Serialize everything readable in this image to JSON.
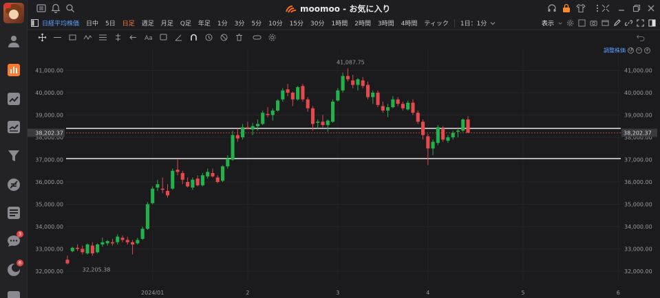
{
  "app": {
    "title": "moomoo - お気に入り"
  },
  "toolbar": {
    "index_label": "日経平均株価",
    "timeframes": [
      {
        "label": "日中",
        "active": false
      },
      {
        "label": "5日",
        "active": false
      },
      {
        "label": "日足",
        "active": true
      },
      {
        "label": "週足",
        "active": false
      },
      {
        "label": "月足",
        "active": false
      },
      {
        "label": "Q足",
        "active": false
      },
      {
        "label": "年足",
        "active": false
      },
      {
        "label": "1分",
        "active": false
      },
      {
        "label": "3分",
        "active": false
      },
      {
        "label": "5分",
        "active": false
      },
      {
        "label": "10分",
        "active": false
      },
      {
        "label": "15分",
        "active": false
      },
      {
        "label": "30分",
        "active": false
      },
      {
        "label": "1時間",
        "active": false
      },
      {
        "label": "2時間",
        "active": false
      },
      {
        "label": "3時間",
        "active": false
      },
      {
        "label": "4時間",
        "active": false
      },
      {
        "label": "ティック",
        "active": false
      }
    ],
    "custom_tf": "1日：1分",
    "display_label": "表示"
  },
  "chart": {
    "adjust_label": "調整株価",
    "current_price_label": "38,202.37",
    "high_label": "41,087.75",
    "low_label": "32,205.38"
  },
  "sidebar": {
    "badges": {
      "messages": "3",
      "news": "6"
    }
  },
  "chart_data": {
    "type": "candlestick",
    "y_ticks": [
      "41,000.00",
      "40,000.00",
      "39,000.00",
      "38,000.00",
      "37,000.00",
      "36,000.00",
      "35,000.00",
      "34,000.00",
      "33,000.00",
      "32,000.00"
    ],
    "y_tick_values": [
      41000,
      40000,
      39000,
      38000,
      37000,
      36000,
      35000,
      34000,
      33000,
      32000
    ],
    "ylim": [
      31600,
      42000
    ],
    "x_labels": [
      "2024/01",
      "2",
      "3",
      "4",
      "5",
      "6"
    ],
    "x_label_index": [
      17,
      36,
      54,
      72,
      91,
      110
    ],
    "horizontal_lines": [
      38400,
      37050
    ],
    "current_price": 38202.37,
    "candles": [
      [
        32520,
        32700,
        32300,
        32350
      ],
      [
        32900,
        33100,
        32850,
        33050
      ],
      [
        33050,
        33200,
        32900,
        33000
      ],
      [
        33000,
        33150,
        32750,
        32850
      ],
      [
        32800,
        33250,
        32750,
        33200
      ],
      [
        33150,
        33300,
        32700,
        32800
      ],
      [
        32850,
        33250,
        32800,
        33200
      ],
      [
        33200,
        33500,
        33100,
        33300
      ],
      [
        33250,
        33400,
        33150,
        33350
      ],
      [
        33300,
        33450,
        33150,
        33250
      ],
      [
        33300,
        33650,
        33200,
        33550
      ],
      [
        33500,
        33600,
        33300,
        33400
      ],
      [
        33400,
        33550,
        33200,
        33300
      ],
      [
        33300,
        33400,
        32750,
        33200
      ],
      [
        33250,
        33500,
        33200,
        33400
      ],
      [
        33450,
        34000,
        33400,
        33900
      ],
      [
        33900,
        35100,
        33850,
        35000
      ],
      [
        35050,
        35800,
        35000,
        35700
      ],
      [
        35750,
        36100,
        35600,
        35900
      ],
      [
        35700,
        36200,
        35500,
        35650
      ],
      [
        35600,
        35900,
        35300,
        35400
      ],
      [
        35700,
        36600,
        35650,
        36500
      ],
      [
        36550,
        37000,
        36300,
        36450
      ],
      [
        36400,
        36500,
        35900,
        36100
      ],
      [
        36000,
        36200,
        35750,
        35800
      ],
      [
        35750,
        36200,
        35650,
        36100
      ],
      [
        36150,
        36300,
        35800,
        35850
      ],
      [
        35850,
        36400,
        35800,
        36300
      ],
      [
        36250,
        36600,
        36150,
        36450
      ],
      [
        36400,
        36600,
        36200,
        36250
      ],
      [
        36200,
        36300,
        35950,
        36000
      ],
      [
        36050,
        36750,
        36000,
        36700
      ],
      [
        36700,
        37200,
        36600,
        37050
      ],
      [
        37000,
        38300,
        36950,
        38100
      ],
      [
        38100,
        38400,
        37800,
        37950
      ],
      [
        38000,
        38600,
        37900,
        38450
      ],
      [
        38450,
        38700,
        38350,
        38400
      ],
      [
        38350,
        38650,
        38100,
        38500
      ],
      [
        38500,
        38800,
        38300,
        38600
      ],
      [
        38600,
        39200,
        38550,
        39100
      ],
      [
        39050,
        39350,
        38900,
        39000
      ],
      [
        39000,
        39300,
        38750,
        39200
      ],
      [
        39200,
        39700,
        39150,
        39650
      ],
      [
        39700,
        40200,
        39600,
        40100
      ],
      [
        40150,
        40400,
        39850,
        40000
      ],
      [
        40000,
        40050,
        39400,
        39700
      ],
      [
        39700,
        40300,
        39650,
        40250
      ],
      [
        40300,
        40400,
        39600,
        39700
      ],
      [
        39700,
        39800,
        39150,
        39300
      ],
      [
        39300,
        39400,
        38300,
        38600
      ],
      [
        38650,
        38800,
        38400,
        38700
      ],
      [
        38700,
        39000,
        38450,
        38550
      ],
      [
        38550,
        38800,
        38250,
        38750
      ],
      [
        38700,
        39700,
        38650,
        39600
      ],
      [
        39650,
        40200,
        39600,
        40100
      ],
      [
        40100,
        40900,
        40000,
        40750
      ],
      [
        40750,
        41087,
        40500,
        40600
      ],
      [
        40550,
        40800,
        40200,
        40350
      ],
      [
        40350,
        40650,
        40100,
        40600
      ],
      [
        40550,
        40700,
        40200,
        40300
      ],
      [
        40350,
        40500,
        39700,
        39800
      ],
      [
        39800,
        40100,
        39500,
        40000
      ],
      [
        40000,
        40100,
        39350,
        39450
      ],
      [
        39400,
        39600,
        39100,
        39200
      ],
      [
        39200,
        39500,
        38900,
        39350
      ],
      [
        39350,
        39850,
        39300,
        39700
      ],
      [
        39700,
        39800,
        39400,
        39500
      ],
      [
        39500,
        39600,
        39200,
        39300
      ],
      [
        39250,
        39650,
        39200,
        39550
      ],
      [
        39550,
        39700,
        39000,
        39100
      ],
      [
        39100,
        39200,
        38600,
        38700
      ],
      [
        38700,
        38800,
        37900,
        38100
      ],
      [
        38050,
        38150,
        36750,
        37500
      ],
      [
        37500,
        37900,
        37200,
        37800
      ],
      [
        37750,
        38550,
        37650,
        38450
      ],
      [
        38400,
        38500,
        37800,
        37900
      ],
      [
        37850,
        38100,
        37750,
        38000
      ],
      [
        38000,
        38300,
        37900,
        38200
      ],
      [
        38250,
        38400,
        38000,
        38300
      ],
      [
        38300,
        38850,
        38250,
        38800
      ],
      [
        38800,
        38950,
        38200,
        38202
      ]
    ]
  }
}
